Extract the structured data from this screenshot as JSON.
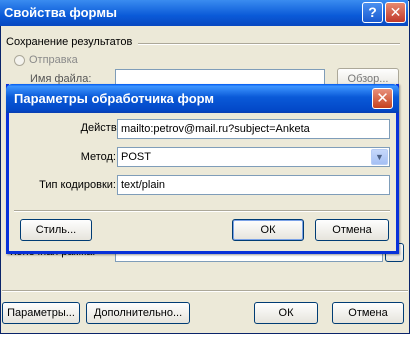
{
  "background_dialog": {
    "title": "Свойства формы",
    "help_glyph": "?",
    "close_glyph": "✕",
    "group_title": "Сохранение результатов",
    "radio_send_label": "Отправка",
    "file_name_label": "Имя файла:",
    "browse_button": "Обзор...",
    "final_frame_label": "Конечная рамка:",
    "ellipsis_button": "...",
    "buttons": {
      "params": "Параметры...",
      "advanced": "Дополнительно...",
      "ok": "ОК",
      "cancel": "Отмена"
    }
  },
  "handler_dialog": {
    "title": "Параметры обработчика форм",
    "close_glyph": "✕",
    "action_label": "Действие:",
    "action_value": "mailto:petrov@mail.ru?subject=Anketa",
    "method_label": "Метод:",
    "method_value": "POST",
    "encoding_label": "Тип кодировки:",
    "encoding_value": "text/plain",
    "buttons": {
      "style": "Стиль...",
      "ok": "ОК",
      "cancel": "Отмена"
    }
  },
  "icons": {
    "radio": "radio-icon",
    "combo_arrow": "chevron-down-icon",
    "close": "close-icon",
    "help": "help-icon"
  },
  "colors": {
    "titlebar_blue": "#0a5ad8",
    "dialog_face": "#ece9d8",
    "close_red": "#c5421f",
    "input_border": "#7f9db9"
  }
}
